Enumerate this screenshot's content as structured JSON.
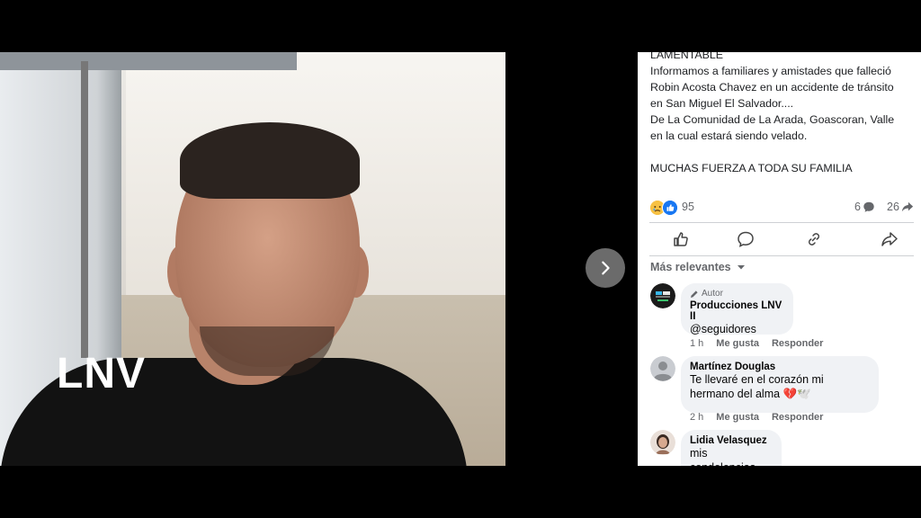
{
  "photo": {
    "watermark": "LNV"
  },
  "post": {
    "lines": [
      "LAMENTABLE",
      "Informamos a familiares y amistades que falleció",
      "Robin Acosta Chavez en un accidente de tránsito",
      "en San Miguel El Salvador....",
      "De La Comunidad de La Arada, Goascoran, Valle",
      "en la cual estará siendo velado."
    ],
    "closing": "MUCHAS FUERZA A TODA SU FAMILIA"
  },
  "reactions": {
    "count": "95",
    "comments": "6",
    "shares": "26"
  },
  "sort": {
    "label": "Más relevantes"
  },
  "comments": [
    {
      "badge": "Autor",
      "name": "Producciones LNV II",
      "text": "@seguidores",
      "time": "1 h",
      "like": "Me gusta",
      "reply": "Responder"
    },
    {
      "name": "Martínez Douglas",
      "text_line1": "Te llevaré en el corazón mi",
      "text_line2": "hermano del alma 💔🕊️",
      "time": "2 h",
      "like": "Me gusta",
      "reply": "Responder"
    },
    {
      "name": "Lidia Velasquez",
      "text": "mis condolencias"
    }
  ],
  "colors": {
    "accent": "#1877f2",
    "muted": "#65676b",
    "bubble": "#f0f2f5"
  }
}
